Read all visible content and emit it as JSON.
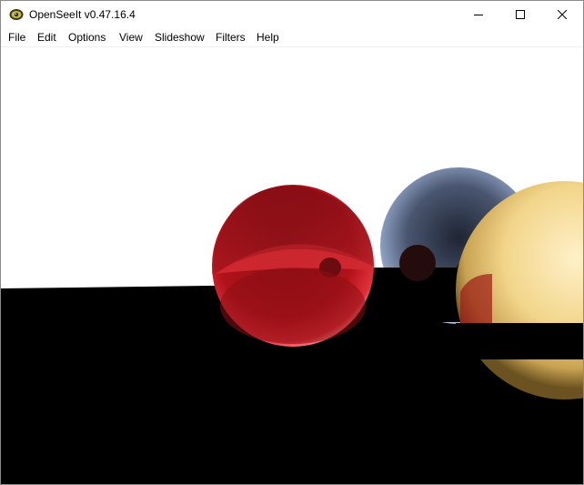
{
  "window": {
    "title": "OpenSeeIt v0.47.16.4",
    "icon": "openseeit-app-icon"
  },
  "controls": {
    "minimize_icon": "minimize-icon",
    "maximize_icon": "maximize-icon",
    "close_icon": "close-icon"
  },
  "menu": {
    "items": [
      {
        "label": "File"
      },
      {
        "label": "Edit"
      },
      {
        "label": "Options"
      },
      {
        "label": "View"
      },
      {
        "label": "Slideshow"
      },
      {
        "label": "Filters"
      },
      {
        "label": "Help"
      }
    ]
  },
  "image": {
    "subject": "raytraced spheres",
    "colors": {
      "background": "#ffffff",
      "floor": "#000000",
      "red_sphere": "#c0141c",
      "blue_sphere": "#6f7fa0",
      "yellow_sphere": "#f2d58a"
    }
  }
}
